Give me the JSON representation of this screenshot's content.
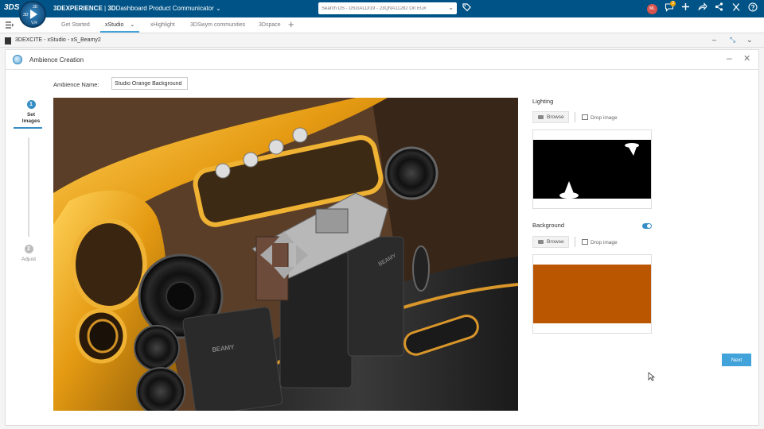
{
  "topbar": {
    "ds_logo": "3DS",
    "compass": {
      "top": "3D",
      "left": "3D",
      "right": "V,R",
      "play": "play-icon"
    },
    "brand_bold": "3DEXPERIENCE",
    "brand_separator": " | ",
    "brand_app_bold": "3D",
    "brand_app": "Dashboard",
    "brand_product": "Product Communicator",
    "brand_chevron": "⌄",
    "search_placeholder": "Search DS - DSGALDI19 - 23QNA11282 On EU#",
    "search_chevron": "⌄",
    "avatar_initials": "ML",
    "notification_count": "3",
    "icons": [
      "tag-icon",
      "chat-icon",
      "plus-icon",
      "share-icon",
      "share-network-icon",
      "tools-icon",
      "help-icon"
    ]
  },
  "tabs": [
    {
      "label": "Get Started",
      "active": false
    },
    {
      "label": "xStudio",
      "active": true,
      "chevron": "⌄"
    },
    {
      "label": "xHighlight",
      "active": false
    },
    {
      "label": "3DSwym communities",
      "active": false
    },
    {
      "label": "3Dspace",
      "active": false
    }
  ],
  "app_header": {
    "title": "3DEXCITE - xStudio - xS_Beamy2",
    "controls": [
      "–",
      "⤡",
      "⌄"
    ]
  },
  "dialog": {
    "title": "Ambience Creation",
    "min_icon": "–",
    "close_icon": "✕",
    "steps": [
      {
        "number": "1",
        "label_line1": "Set",
        "label_line2": "Images",
        "active": true
      },
      {
        "number": "2",
        "label_line1": "Adjust",
        "active": false
      }
    ],
    "ambience_name_label": "Ambience Name:",
    "ambience_name_value": "Studio Orange Background",
    "lighting": {
      "title": "Lighting",
      "browse_label": "Browse",
      "drop_label": "Drop image"
    },
    "background": {
      "title": "Background",
      "toggle_on": true,
      "browse_label": "Browse",
      "drop_label": "Drop image",
      "color": "#bb5600"
    },
    "next_label": "Next"
  },
  "viewport_labels": {
    "brand_text_1": "BEAMY",
    "brand_text_2": "BEAMY"
  },
  "colors": {
    "topbar": "#005386",
    "accent": "#42a2da",
    "gold": "#e8a21c"
  }
}
